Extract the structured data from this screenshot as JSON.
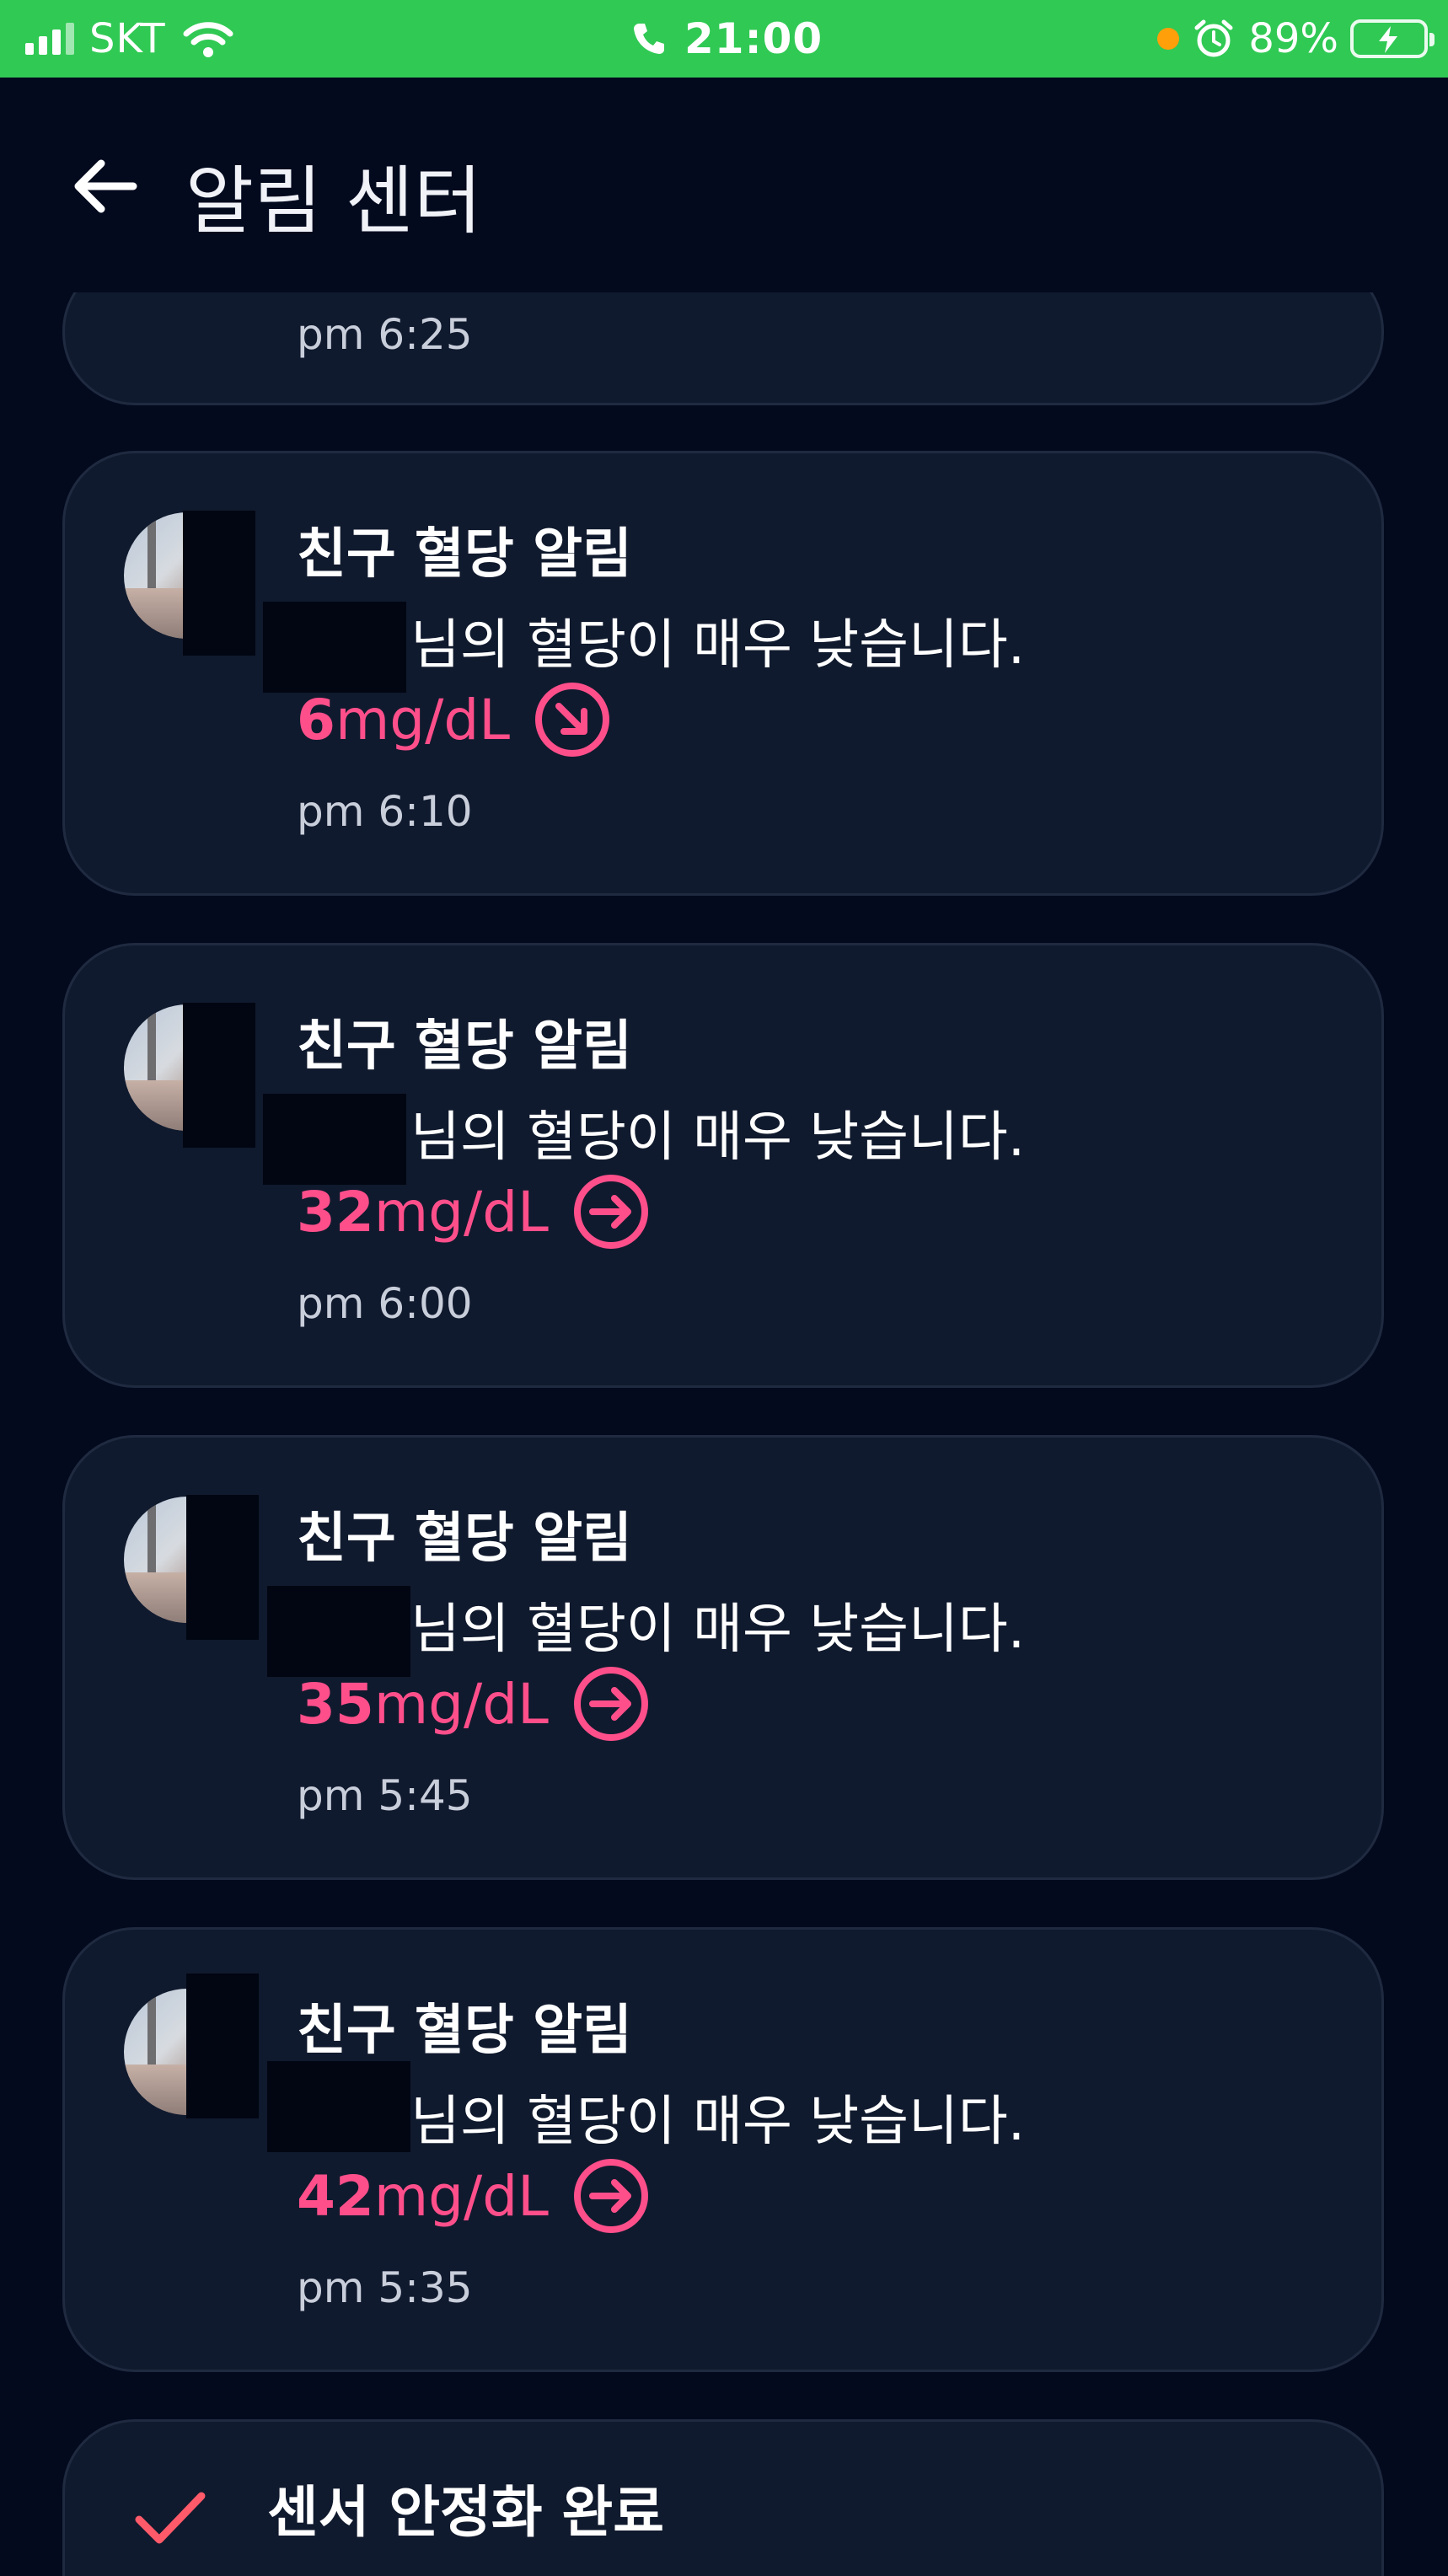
{
  "status_bar": {
    "carrier": "SKT",
    "time": "21:00",
    "battery": "89%",
    "icons": [
      "signal-icon",
      "wifi-icon",
      "phone-icon",
      "privacy-dot",
      "alarm-icon",
      "battery-charging-icon"
    ]
  },
  "header": {
    "title": "알림 센터",
    "back_icon": "arrow-left-icon"
  },
  "colors": {
    "status_bar": "#30c954",
    "background": "#030a1e",
    "card": "#101a2e",
    "glucose_low": "#ff4f8b"
  },
  "notifications": [
    {
      "time": "pm 6:25"
    },
    {
      "title": "친구 혈당 알림",
      "message": "님의 혈당이 매우 낮습니다.",
      "value": "6",
      "unit": "mg/dL",
      "trend": "arrow-down-right-icon",
      "time": "pm 6:10"
    },
    {
      "title": "친구 혈당 알림",
      "message": "님의 혈당이 매우 낮습니다.",
      "value": "32",
      "unit": "mg/dL",
      "trend": "arrow-right-icon",
      "time": "pm 6:00"
    },
    {
      "title": "친구 혈당 알림",
      "message": "님의 혈당이 매우 낮습니다.",
      "value": "35",
      "unit": "mg/dL",
      "trend": "arrow-right-icon",
      "time": "pm 5:45"
    },
    {
      "title": "친구 혈당 알림",
      "message": "님의 혈당이 매우 낮습니다.",
      "value": "42",
      "unit": "mg/dL",
      "trend": "arrow-right-icon",
      "time": "pm 5:35"
    },
    {
      "title": "센서 안정화 완료",
      "icon": "check-icon"
    }
  ]
}
